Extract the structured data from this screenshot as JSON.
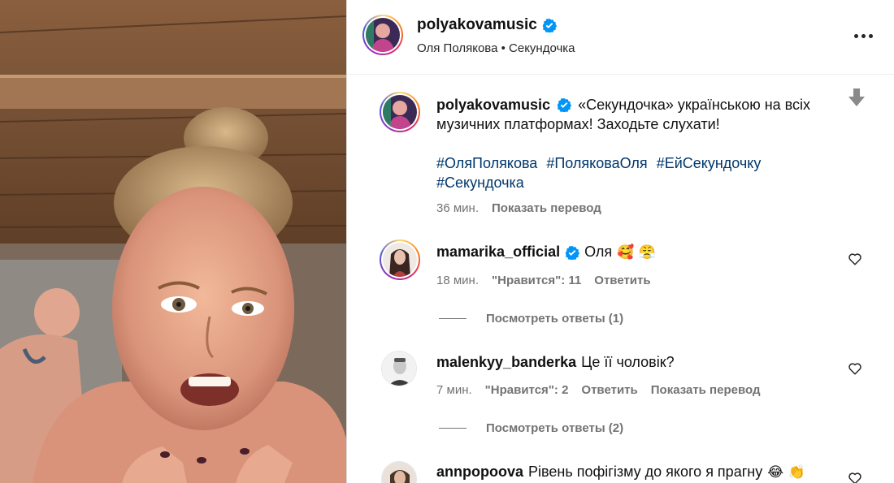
{
  "header": {
    "username": "polyakovamusic",
    "subtitle": "Оля Полякова • Секундочка"
  },
  "caption": {
    "username": "polyakovamusic",
    "text": "«Секундочка» українською на всіх музичних платформах! Заходьте слухати!",
    "hashtags": [
      "#ОляПолякова",
      "#ПоляковаОля",
      "#ЕйСекундочку",
      "#Секундочка"
    ],
    "time": "36 мин.",
    "translate_label": "Показать перевод"
  },
  "comments": [
    {
      "username": "mamarika_official",
      "verified": true,
      "text": "Оля",
      "emojis": "🥰 😤",
      "time": "18 мин.",
      "likes": "\"Нравится\": 11",
      "reply_label": "Ответить",
      "view_replies": "Посмотреть ответы (1)"
    },
    {
      "username": "malenkyy_banderka",
      "verified": false,
      "text": "Це її чоловік?",
      "time": "7 мин.",
      "likes": "\"Нравится\": 2",
      "reply_label": "Ответить",
      "translate_label": "Показать перевод",
      "view_replies": "Посмотреть ответы (2)"
    },
    {
      "username": "annpopoova",
      "verified": false,
      "text": "Рівень пофігізму до якого я прагну",
      "emojis": "😂 👏"
    }
  ],
  "icons": {
    "more": "more-options-icon",
    "verified": "verified-badge-icon",
    "translate": "translate-icon",
    "like": "heart-icon"
  },
  "colors": {
    "link": "#00376b",
    "muted": "#737373",
    "verified": "#0095f6"
  }
}
